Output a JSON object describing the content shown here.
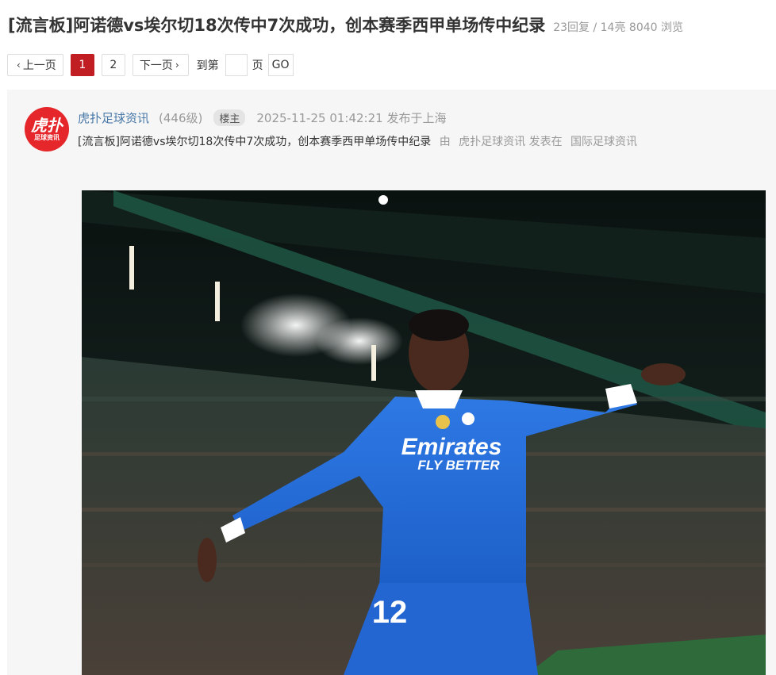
{
  "thread": {
    "title": "[流言板]阿诺德vs埃尔切18次传中7次成功，创本赛季西甲单场传中纪录",
    "stats": "23回复 / 14亮 8040 浏览"
  },
  "pager": {
    "prev_label": "上一页",
    "pages": [
      "1",
      "2"
    ],
    "current_page": "1",
    "next_label": "下一页",
    "goto_label": "到第",
    "page_input_value": "",
    "page_unit": "页",
    "go_label": "GO"
  },
  "post": {
    "avatar": {
      "text_big": "虎扑",
      "text_small": "足球资讯"
    },
    "author": "虎扑足球资讯",
    "level": "(446级)",
    "badge": "楼主",
    "time": "2025-11-25 01:42:21 发布于上海",
    "subline": {
      "title": "[流言板]阿诺德vs埃尔切18次传中7次成功，创本赛季西甲单场传中纪录",
      "by": "由",
      "by_author": "虎扑足球资讯",
      "posted_in": "发表在",
      "board": "国际足球资讯"
    },
    "photo": {
      "jersey_sponsor_line1": "Emirates",
      "jersey_sponsor_line2": "FLY BETTER",
      "jersey_number": "12"
    }
  },
  "colors": {
    "accent_red": "#c01e22",
    "author_blue": "#4878a8",
    "muted_gray": "#999999",
    "jersey_blue": "#2a6fdc"
  }
}
